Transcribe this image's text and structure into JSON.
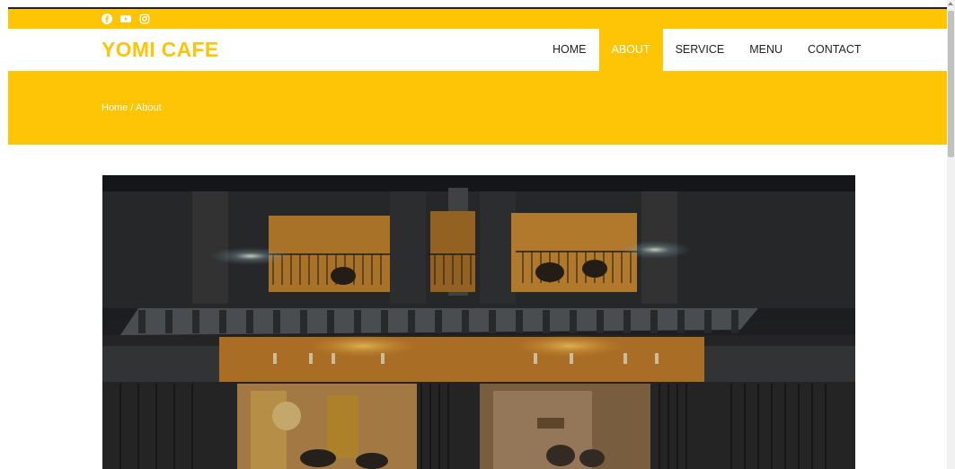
{
  "topbar": {
    "social_icons": [
      "facebook-icon",
      "youtube-icon",
      "instagram-icon"
    ]
  },
  "nav": {
    "logo": "YOMI CAFE",
    "items": [
      {
        "label": "HOME",
        "active": false
      },
      {
        "label": "ABOUT",
        "active": true
      },
      {
        "label": "SERVICE",
        "active": false
      },
      {
        "label": "MENU",
        "active": false
      },
      {
        "label": "CONTACT",
        "active": false
      }
    ]
  },
  "hero": {
    "breadcrumb": "Home / About"
  },
  "colors": {
    "accent": "#fec506",
    "text": "#222222",
    "white": "#ffffff"
  }
}
